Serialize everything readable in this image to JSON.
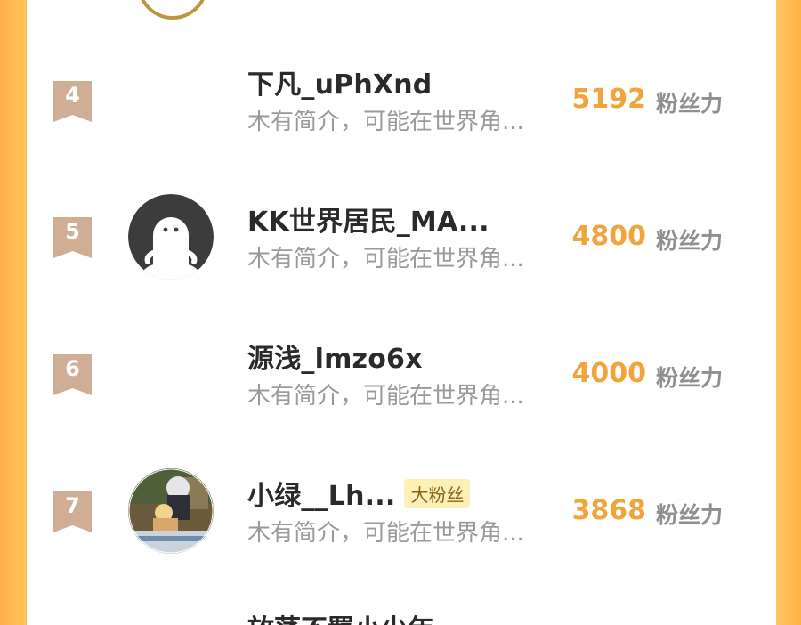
{
  "ranking": {
    "score_unit": "粉丝力",
    "rows": [
      {
        "rank": "4",
        "name": "下凡_uPhXnd",
        "bio": "木有简介，可能在世界角...",
        "score": "5192",
        "tag": ""
      },
      {
        "rank": "5",
        "name": "KK世界居民_MA...",
        "bio": "木有简介，可能在世界角...",
        "score": "4800",
        "tag": ""
      },
      {
        "rank": "6",
        "name": "源浅_lmzo6x",
        "bio": "木有简介，可能在世界角...",
        "score": "4000",
        "tag": ""
      },
      {
        "rank": "7",
        "name": "小绿__Lh...",
        "bio": "木有简介，可能在世界角...",
        "score": "3868",
        "tag": "大粉丝"
      }
    ],
    "next_row_name": "放荡不羁小少年"
  },
  "colors": {
    "background_accent": "#ffc057",
    "score": "#f0a43b",
    "rank_badge": "#cfae95",
    "fan_tag_bg": "#fdf0b7"
  },
  "icons": {
    "rank_badge": "ribbon-badge-icon",
    "default_avatar": "ghost-avatar-icon"
  }
}
